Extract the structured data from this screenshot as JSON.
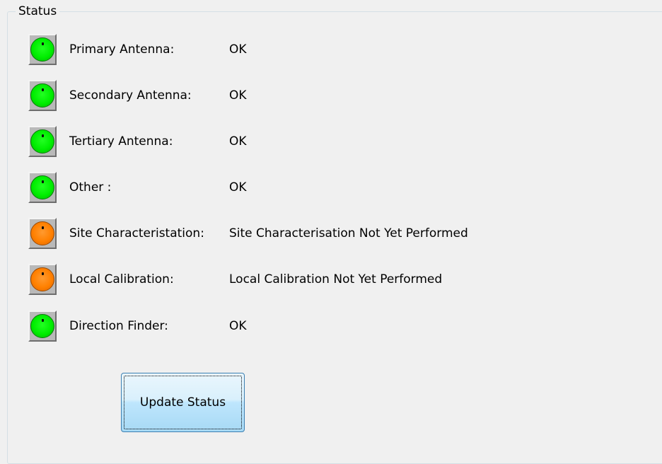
{
  "group": {
    "title": "Status"
  },
  "status_items": [
    {
      "label": "Primary Antenna:",
      "value": "OK",
      "indicator": "green"
    },
    {
      "label": "Secondary Antenna:",
      "value": "OK",
      "indicator": "green"
    },
    {
      "label": "Tertiary Antenna:",
      "value": "OK",
      "indicator": "green"
    },
    {
      "label": "Other :",
      "value": "OK",
      "indicator": "green"
    },
    {
      "label": "Site Characteristation:",
      "value": "Site Characterisation Not Yet Performed",
      "indicator": "orange"
    },
    {
      "label": "Local Calibration:",
      "value": "Local Calibration Not Yet Performed",
      "indicator": "orange"
    },
    {
      "label": "Direction Finder:",
      "value": "OK",
      "indicator": "green"
    }
  ],
  "actions": {
    "update_label": "Update Status"
  },
  "colors": {
    "ok": "#00ee00",
    "warning": "#ff8000",
    "button_border": "#3c7fb1"
  }
}
